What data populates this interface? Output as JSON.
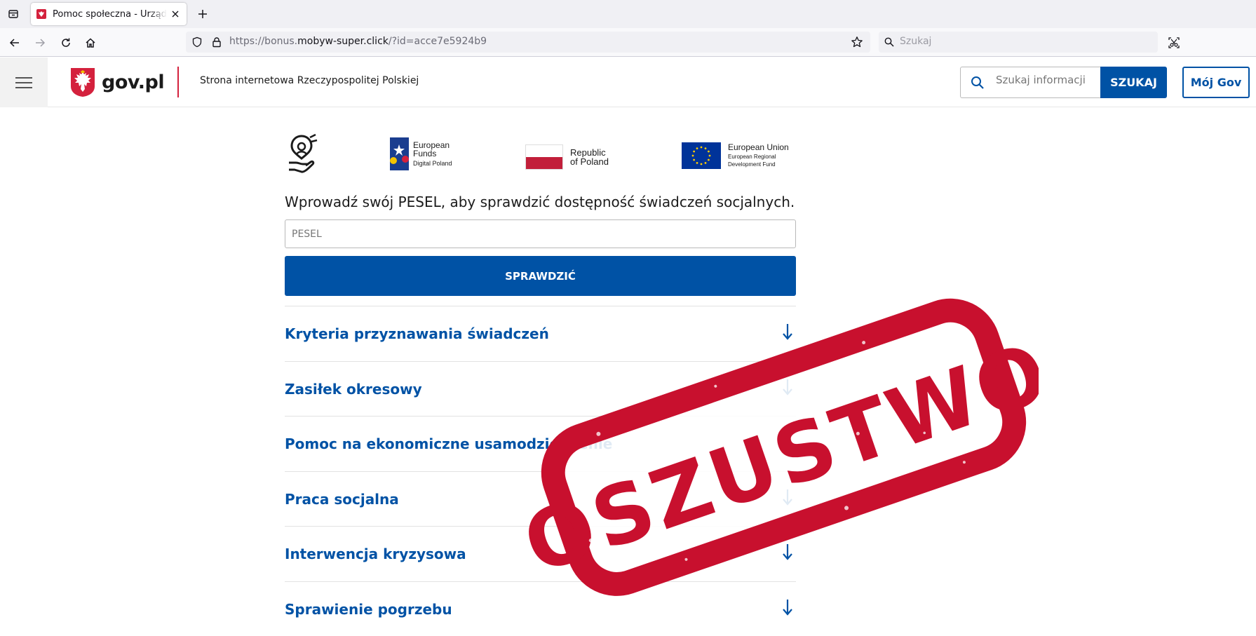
{
  "browser": {
    "tab_title": "Pomoc społeczna - Urząd ds",
    "url_scheme": "https://bonus.",
    "url_domain": "mobyw-super.click",
    "url_path": "/?id=acce7e5924b9",
    "search_placeholder": "Szukaj"
  },
  "header": {
    "brand": "gov.pl",
    "tagline": "Strona internetowa Rzeczypospolitej Polskiej",
    "search_placeholder": "Szukaj informacji",
    "search_button": "SZUKAJ",
    "account_button": "Mój Gov"
  },
  "logos": {
    "eu_funds_line1": "European",
    "eu_funds_line2": "Funds",
    "eu_funds_line3": "Digital Poland",
    "rp_line1": "Republic",
    "rp_line2": "of Poland",
    "eu_line1": "European Union",
    "eu_line2": "European Regional",
    "eu_line3": "Development Fund"
  },
  "form": {
    "prompt": "Wprowadź swój PESEL, aby sprawdzić dostępność świadczeń socjalnych.",
    "pesel_placeholder": "PESEL",
    "submit_label": "SPRAWDZIĆ"
  },
  "accordion": [
    {
      "label": "Kryteria przyznawania świadczeń"
    },
    {
      "label": "Zasiłek okresowy"
    },
    {
      "label": "Pomoc na ekonomiczne usamodzielnienie"
    },
    {
      "label": "Praca socjalna"
    },
    {
      "label": "Interwencja kryzysowa"
    },
    {
      "label": "Sprawienie pogrzebu"
    }
  ],
  "stamp": {
    "text": "OSZUSTWO",
    "color": "#c8102e"
  },
  "colors": {
    "gov_blue": "#0052a5",
    "gov_red": "#d4213d"
  },
  "icons": [
    "tab-list-icon",
    "gov-emblem-icon",
    "close-icon",
    "plus-icon",
    "back-icon",
    "forward-icon",
    "reload-icon",
    "home-icon",
    "shield-icon",
    "lock-icon",
    "star-icon",
    "search-icon",
    "screenshot-icon",
    "menu-icon",
    "arrow-down-icon"
  ]
}
